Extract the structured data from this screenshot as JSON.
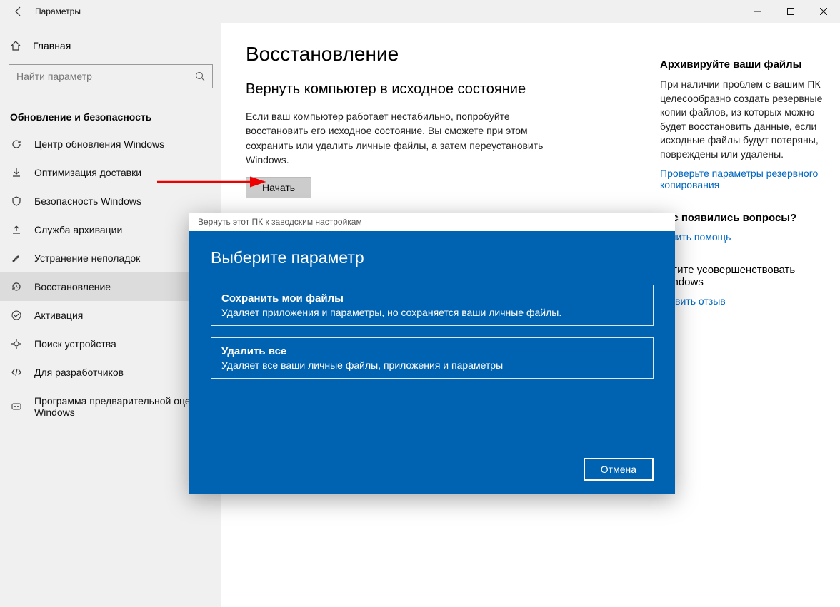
{
  "window": {
    "title": "Параметры"
  },
  "sidebar": {
    "home_label": "Главная",
    "search_placeholder": "Найти параметр",
    "group_title": "Обновление и безопасность",
    "items": [
      {
        "label": "Центр обновления Windows",
        "icon": "sync"
      },
      {
        "label": "Оптимизация доставки",
        "icon": "download"
      },
      {
        "label": "Безопасность Windows",
        "icon": "shield"
      },
      {
        "label": "Служба архивации",
        "icon": "backup"
      },
      {
        "label": "Устранение неполадок",
        "icon": "wrench"
      },
      {
        "label": "Восстановление",
        "icon": "history"
      },
      {
        "label": "Активация",
        "icon": "check"
      },
      {
        "label": "Поиск устройства",
        "icon": "locate"
      },
      {
        "label": "Для разработчиков",
        "icon": "dev"
      },
      {
        "label": "Программа предварительной оценки Windows",
        "icon": "insider"
      }
    ]
  },
  "main": {
    "heading": "Восстановление",
    "sub_heading": "Вернуть компьютер в исходное состояние",
    "description": "Если ваш компьютер работает нестабильно, попробуйте восстановить его исходное состояние. Вы сможете при этом сохранить или удалить личные файлы, а затем переустановить Windows.",
    "start_button": "Начать"
  },
  "aside": {
    "backup_heading": "Архивируйте ваши файлы",
    "backup_text": "При наличии проблем с вашим ПК целесообразно создать резервные копии файлов, из которых можно будет восстановить данные, если исходные файлы будут потеряны, повреждены или удалены.",
    "backup_link": "Проверьте параметры резервного копирования",
    "questions_heading": "вас появились вопросы?",
    "help_link": "лучить помощь",
    "feedback_heading": "могите усовершенствовать Windows",
    "feedback_link": "ставить отзыв"
  },
  "dialog": {
    "title": "Вернуть этот ПК к заводским настройкам",
    "heading": "Выберите параметр",
    "option1_title": "Сохранить мои файлы",
    "option1_desc": "Удаляет приложения и параметры, но сохраняется ваши личные файлы.",
    "option2_title": "Удалить все",
    "option2_desc": "Удаляет все ваши личные файлы, приложения и параметры",
    "cancel": "Отмена"
  }
}
